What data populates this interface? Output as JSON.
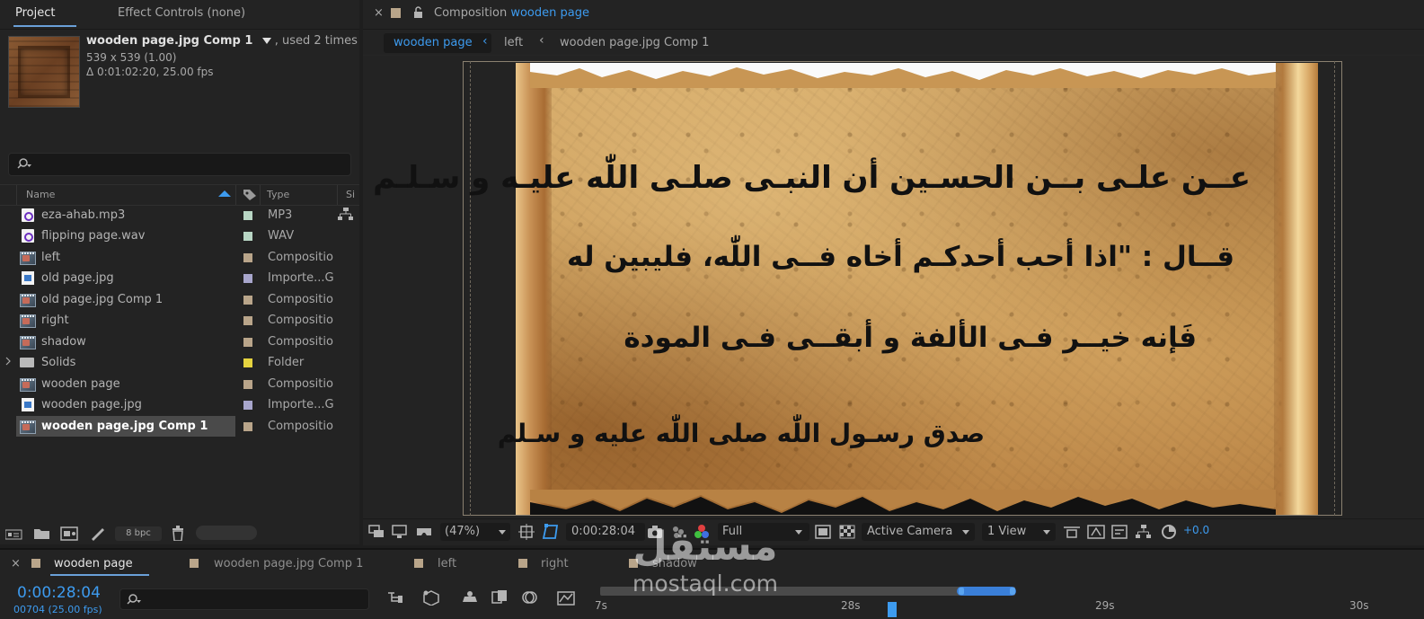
{
  "project_panel": {
    "tab_project": "Project",
    "tab_effect_controls": "Effect Controls (none)",
    "selected_item": {
      "name": "wooden page.jpg Comp 1",
      "usage": ", used 2 times",
      "dimensions": "539 x 539 (1.00)",
      "duration": "Δ 0:01:02:20, 25.00 fps"
    },
    "search_placeholder": "",
    "columns": {
      "name": "Name",
      "type": "Type",
      "size": "Si"
    },
    "items": [
      {
        "name": "eza-ahab.mp3",
        "type": "MP3",
        "icon": "audio-file-icon",
        "label_color": "#b8d6c4"
      },
      {
        "name": "flipping page.wav",
        "type": "WAV",
        "icon": "audio-file-icon",
        "label_color": "#b8d6c4"
      },
      {
        "name": "left",
        "type": "Compositio",
        "icon": "composition-icon",
        "label_color": "#b9a58a"
      },
      {
        "name": "old page.jpg",
        "type": "Importe...G",
        "icon": "image-file-icon",
        "label_color": "#a8a6cc"
      },
      {
        "name": "old page.jpg Comp 1",
        "type": "Compositio",
        "icon": "composition-icon",
        "label_color": "#b9a58a"
      },
      {
        "name": "right",
        "type": "Compositio",
        "icon": "composition-icon",
        "label_color": "#b9a58a"
      },
      {
        "name": "shadow",
        "type": "Compositio",
        "icon": "composition-icon",
        "label_color": "#b9a58a"
      },
      {
        "name": "Solids",
        "type": "Folder",
        "icon": "folder-icon",
        "label_color": "#e5d33f"
      },
      {
        "name": "wooden page",
        "type": "Compositio",
        "icon": "composition-icon",
        "label_color": "#b9a58a"
      },
      {
        "name": "wooden page.jpg",
        "type": "Importe...G",
        "icon": "image-file-icon",
        "label_color": "#a8a6cc"
      },
      {
        "name": "wooden page.jpg Comp 1",
        "type": "Compositio",
        "icon": "composition-icon",
        "label_color": "#b9a58a"
      }
    ],
    "bit_depth": "8 bpc"
  },
  "composition_panel": {
    "tab_prefix": "Composition",
    "tab_comp_name": "wooden page",
    "breadcrumbs": [
      "wooden page",
      "left",
      "wooden page.jpg Comp 1"
    ],
    "verse_lines": [
      "عــن علـى بــن الحسـين أن النبـى صلـى اللّٰه عليـه و سـلـم",
      "قــال : \"اذا أحب أحدكـم أخاه فــى اللّٰه، فليبين له",
      "فَإنه خيــر فـى الألفة و أبقــى فـى المودة",
      "صدق رسـول اللّٰه صلى اللّٰه عليه و سـلم"
    ],
    "toolbar": {
      "zoom": "(47%)",
      "timecode": "0:00:28:04",
      "resolution": "Full",
      "camera": "Active Camera",
      "views": "1 View",
      "exposure": "+0.0"
    }
  },
  "timeline_panel": {
    "tabs": [
      {
        "label": "wooden page",
        "color": "#b9a58a"
      },
      {
        "label": "wooden page.jpg Comp 1",
        "color": "#b9a58a"
      },
      {
        "label": "left",
        "color": "#b9a58a"
      },
      {
        "label": "right",
        "color": "#b9a58a"
      },
      {
        "label": "shadow",
        "color": "#b9a58a"
      }
    ],
    "current_time": "0:00:28:04",
    "frame_info": "00704 (25.00 fps)",
    "ruler_labels": [
      "7s",
      "28s",
      "29s",
      "30s"
    ]
  },
  "watermark": {
    "arabic": "مستقل",
    "latin": "mostaql.com"
  },
  "colors": {
    "accent_blue": "#3d9bef",
    "parchment": "#c4924f"
  }
}
